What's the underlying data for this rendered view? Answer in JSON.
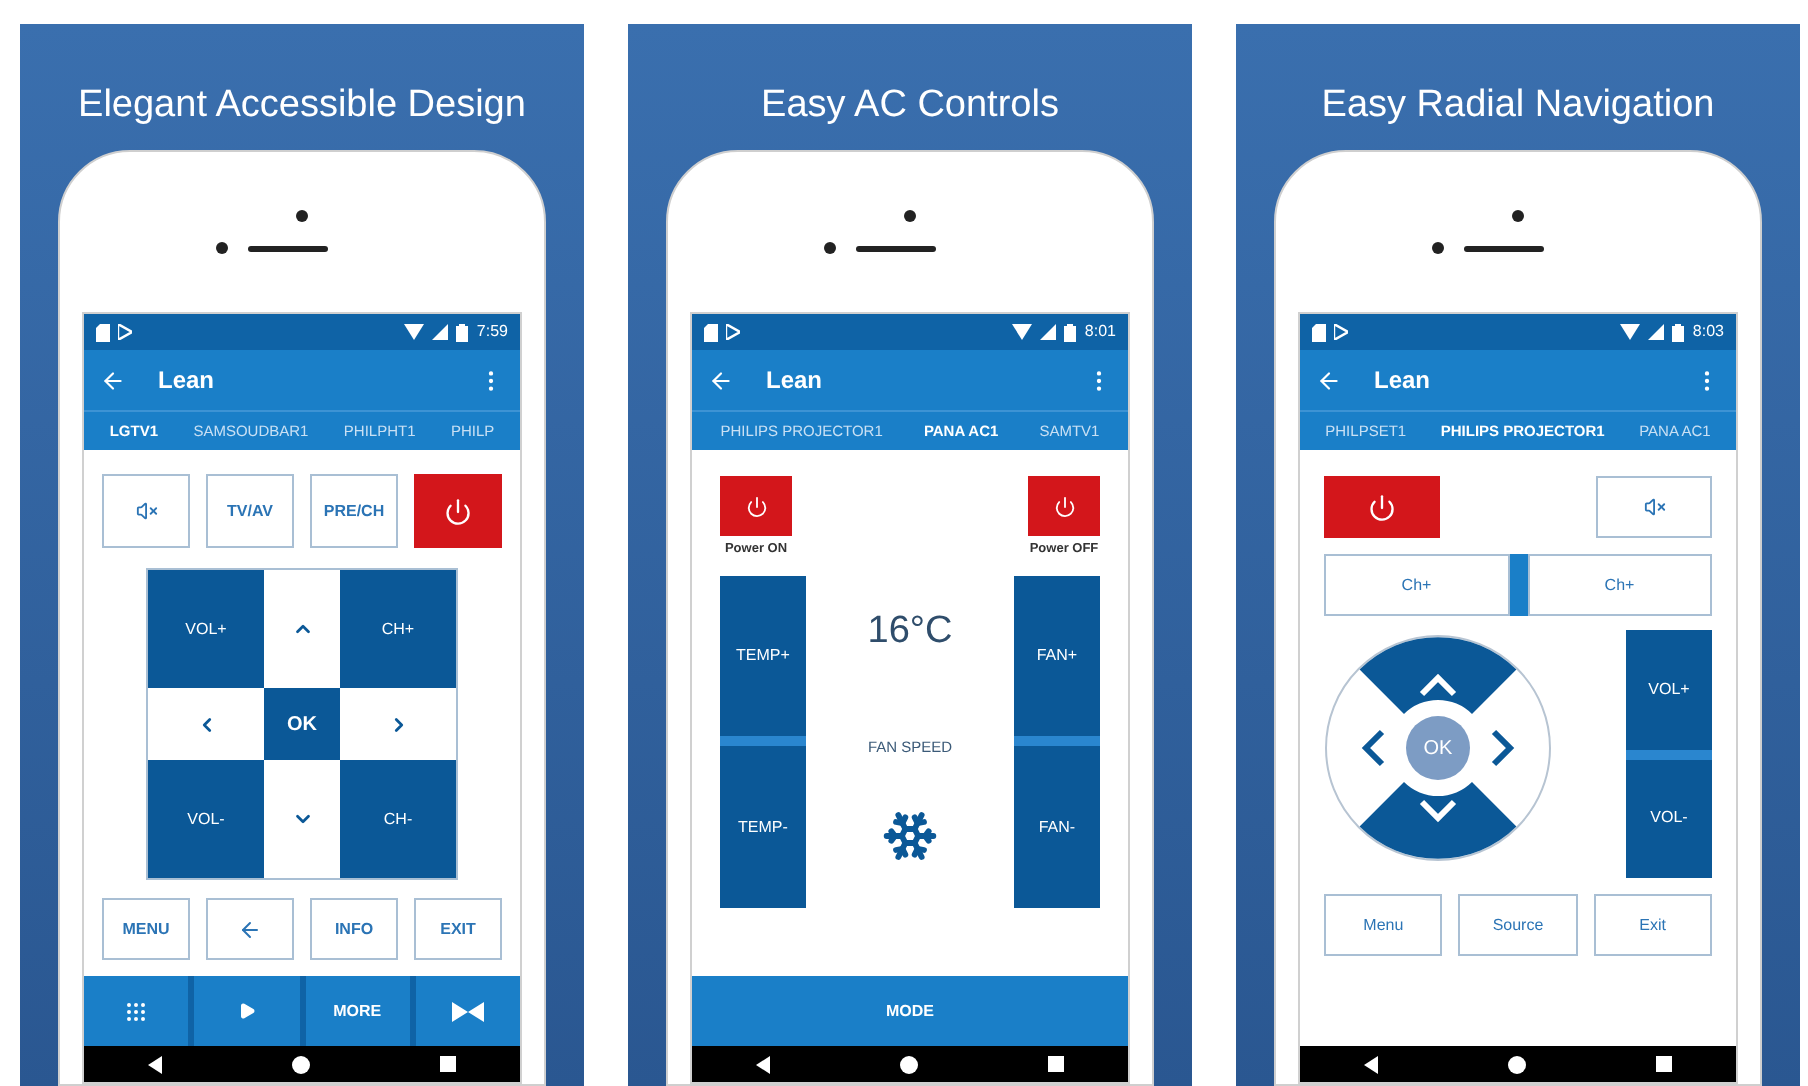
{
  "panels": [
    {
      "heading": "Elegant Accessible Design",
      "screen": {
        "kind": "tv",
        "time": "7:59",
        "title": "Lean",
        "tabs": [
          {
            "label": "LGTV1",
            "selected": true
          },
          {
            "label": "SAMSOUDBAR1",
            "selected": false
          },
          {
            "label": "PHILPHT1",
            "selected": false
          },
          {
            "label": "PHILP",
            "selected": false
          }
        ],
        "top_buttons": [
          {
            "kind": "mute"
          },
          {
            "kind": "text",
            "label": "TV/AV"
          },
          {
            "kind": "text",
            "label": "PRE/CH"
          },
          {
            "kind": "power"
          }
        ],
        "pad": [
          {
            "kind": "key",
            "label": "VOL+"
          },
          {
            "kind": "up"
          },
          {
            "kind": "key",
            "label": "CH+"
          },
          {
            "kind": "left"
          },
          {
            "kind": "ok",
            "label": "OK"
          },
          {
            "kind": "right"
          },
          {
            "kind": "key",
            "label": "VOL-"
          },
          {
            "kind": "down"
          },
          {
            "kind": "key",
            "label": "CH-"
          }
        ],
        "bottom_buttons": [
          {
            "kind": "text",
            "label": "MENU"
          },
          {
            "kind": "back"
          },
          {
            "kind": "text",
            "label": "INFO"
          },
          {
            "kind": "text",
            "label": "EXIT"
          }
        ],
        "bar": [
          {
            "kind": "keypad"
          },
          {
            "kind": "play"
          },
          {
            "kind": "text",
            "label": "MORE"
          },
          {
            "kind": "bowtie"
          }
        ]
      }
    },
    {
      "heading": "Easy AC Controls",
      "screen": {
        "kind": "ac",
        "time": "8:01",
        "title": "Lean",
        "tabs": [
          {
            "label": "PHILIPS PROJECTOR1",
            "selected": false
          },
          {
            "label": "PANA AC1",
            "selected": true
          },
          {
            "label": "SAMTV1",
            "selected": false
          }
        ],
        "power": [
          {
            "label": "Power ON"
          },
          {
            "label": "Power OFF"
          }
        ],
        "left_column": [
          "TEMP+",
          "TEMP-"
        ],
        "temperature": "16°C",
        "fan_label": "FAN SPEED",
        "right_column": [
          "FAN+",
          "FAN-"
        ],
        "bar": [
          {
            "kind": "text",
            "label": "MODE"
          }
        ]
      }
    },
    {
      "heading": "Easy Radial Navigation",
      "screen": {
        "kind": "radial",
        "time": "8:03",
        "title": "Lean",
        "tabs": [
          {
            "label": "PHILPSET1",
            "selected": false
          },
          {
            "label": "PHILIPS PROJECTOR1",
            "selected": true
          },
          {
            "label": "PANA AC1",
            "selected": false
          }
        ],
        "top_buttons": [
          {
            "kind": "power"
          },
          {
            "kind": "mute"
          }
        ],
        "channel_buttons": [
          "Ch+",
          "Ch+"
        ],
        "ok_label": "OK",
        "volume": [
          "VOL+",
          "VOL-"
        ],
        "bottom_buttons": [
          {
            "kind": "text",
            "label": "Menu"
          },
          {
            "kind": "text",
            "label": "Source"
          },
          {
            "kind": "text",
            "label": "Exit"
          }
        ]
      }
    }
  ]
}
